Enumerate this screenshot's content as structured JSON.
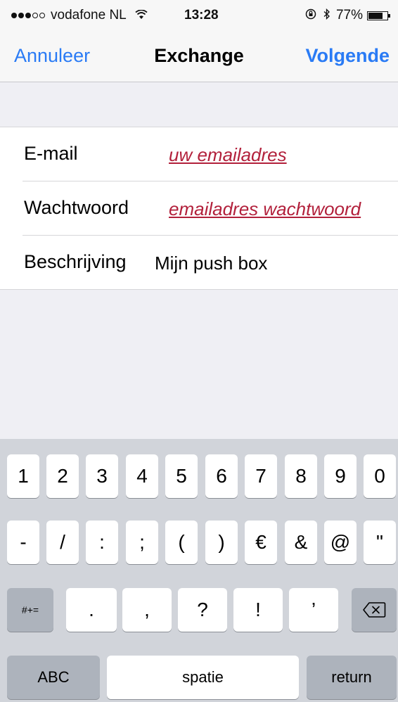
{
  "status_bar": {
    "carrier": "vodafone NL",
    "time": "13:28",
    "battery": "77%",
    "battery_level": 0.77,
    "signal_dots_filled": 3,
    "signal_dots_total": 5,
    "icons": [
      "wifi-icon",
      "orientation-lock-icon",
      "bluetooth-icon",
      "battery-icon"
    ]
  },
  "nav": {
    "cancel": "Annuleer",
    "title": "Exchange",
    "next": "Volgende"
  },
  "form": {
    "rows": [
      {
        "label": "E-mail",
        "value": "uw emailadres",
        "placeholder_style": true
      },
      {
        "label": "Wachtwoord",
        "value": "emailadres wachtwoord",
        "placeholder_style": true
      },
      {
        "label": "Beschrijving",
        "value": "Mijn push box",
        "placeholder_style": false
      }
    ]
  },
  "keyboard": {
    "row1": [
      "1",
      "2",
      "3",
      "4",
      "5",
      "6",
      "7",
      "8",
      "9",
      "0"
    ],
    "row2": [
      "-",
      "/",
      ":",
      ";",
      "(",
      ")",
      "€",
      "&",
      "@",
      "\""
    ],
    "row3_mode": "#+=",
    "row3": [
      ".",
      ",",
      "?",
      "!",
      "’"
    ],
    "delete_icon": "backspace-icon",
    "abc": "ABC",
    "space": "spatie",
    "return": "return"
  },
  "colors": {
    "accent": "#2a7bf5",
    "placeholder": "#b2203b"
  }
}
